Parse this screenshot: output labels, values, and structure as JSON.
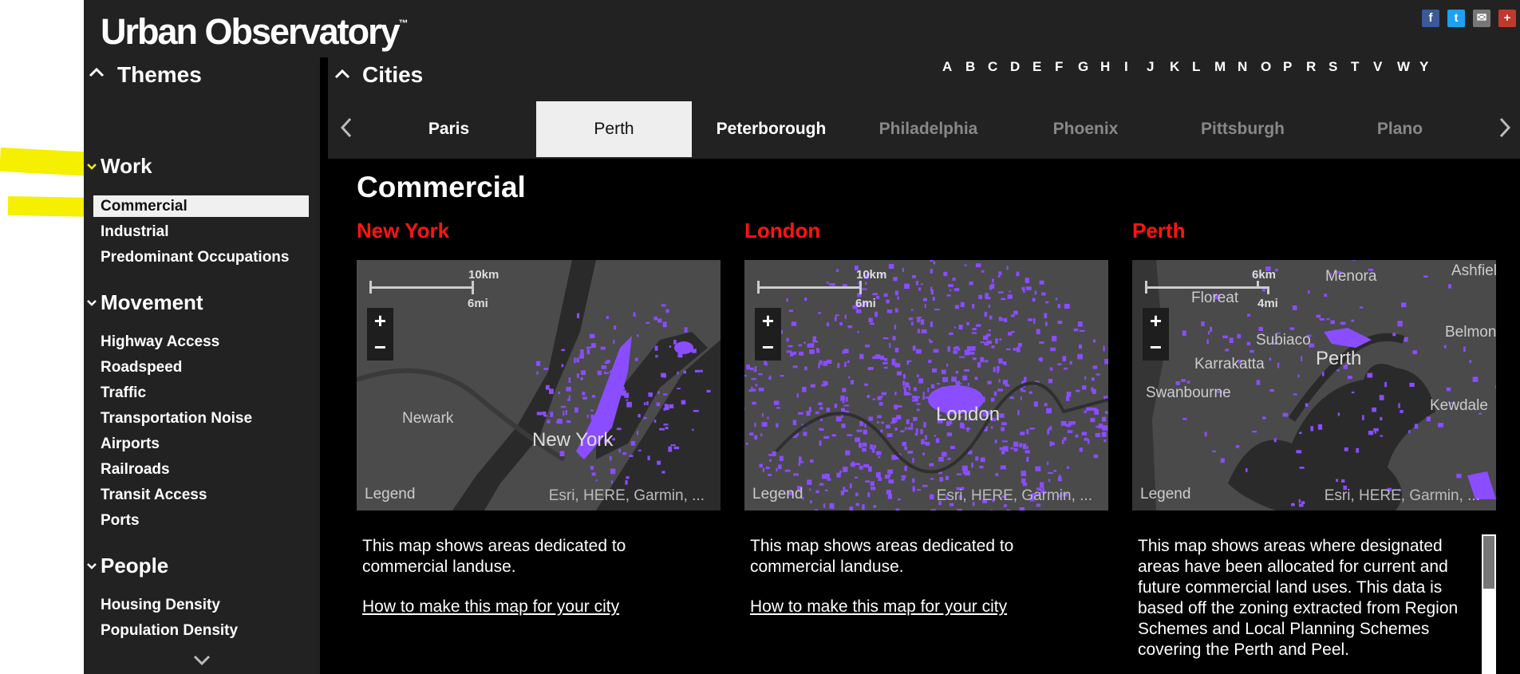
{
  "app": {
    "title": "Urban Observatory",
    "trademark": "™"
  },
  "social": [
    {
      "icon": "facebook-icon",
      "glyph": "f",
      "color": "#3b5998"
    },
    {
      "icon": "twitter-icon",
      "glyph": "t",
      "color": "#1da1f2"
    },
    {
      "icon": "mail-icon",
      "glyph": "✉",
      "color": "#777777"
    },
    {
      "icon": "plus-icon",
      "glyph": "+",
      "color": "#c0392b"
    }
  ],
  "themes_panel": {
    "title": "Themes",
    "categories": [
      {
        "title": "Work",
        "items": [
          "Commercial",
          "Industrial",
          "Predominant Occupations"
        ]
      },
      {
        "title": "Movement",
        "items": [
          "Highway Access",
          "Roadspeed",
          "Traffic",
          "Transportation Noise",
          "Airports",
          "Railroads",
          "Transit Access",
          "Ports"
        ]
      },
      {
        "title": "People",
        "items": [
          "Housing Density",
          "Population Density"
        ]
      }
    ],
    "selected_item": "Commercial"
  },
  "cities_panel": {
    "title": "Cities",
    "letters": [
      "A",
      "B",
      "C",
      "D",
      "E",
      "F",
      "G",
      "H",
      "I",
      "J",
      "K",
      "L",
      "M",
      "N",
      "O",
      "P",
      "R",
      "S",
      "T",
      "V",
      "W",
      "Y"
    ],
    "tabs": [
      "Paris",
      "Perth",
      "Peterborough",
      "Philadelphia",
      "Phoenix",
      "Pittsburgh",
      "Plano"
    ],
    "active_tab": "Perth"
  },
  "content": {
    "section_title": "Commercial",
    "cards": [
      {
        "city": "New York",
        "map": {
          "scale_km": "10km",
          "scale_mi": "6mi",
          "zoom_in": "+",
          "zoom_out": "−",
          "legend": "Legend",
          "attribution": "Esri, HERE, Garmin, ...",
          "labels": [
            "Newark",
            "New York"
          ]
        },
        "description": "This map shows areas dedicated to commercial landuse.",
        "link": "How to make this map for your city"
      },
      {
        "city": "London",
        "map": {
          "scale_km": "10km",
          "scale_mi": "6mi",
          "zoom_in": "+",
          "zoom_out": "−",
          "legend": "Legend",
          "attribution": "Esri, HERE, Garmin, ...",
          "labels": [
            "London"
          ]
        },
        "description": "This map shows areas dedicated to commercial landuse.",
        "link": "How to make this map for your city"
      },
      {
        "city": "Perth",
        "map": {
          "scale_km": "6km",
          "scale_mi": "4mi",
          "zoom_in": "+",
          "zoom_out": "−",
          "legend": "Legend",
          "attribution": "Esri, HERE, Garmin, ...",
          "labels": [
            "Menora",
            "Ashfield",
            "Floreat",
            "Subiaco",
            "Perth",
            "Belmont",
            "Karrakatta",
            "Swanbourne",
            "Kewdale"
          ]
        },
        "description": "This map shows areas where designated areas have been allocated for current and future commercial land uses.  This data is based off the zoning extracted from Region Schemes and Local Planning Schemes covering the Perth and Peel."
      }
    ]
  },
  "colors": {
    "highlight": "#f4f000",
    "card_title": "#ff1414",
    "map_feature": "#8a4dff",
    "panel_bg": "#222222"
  }
}
